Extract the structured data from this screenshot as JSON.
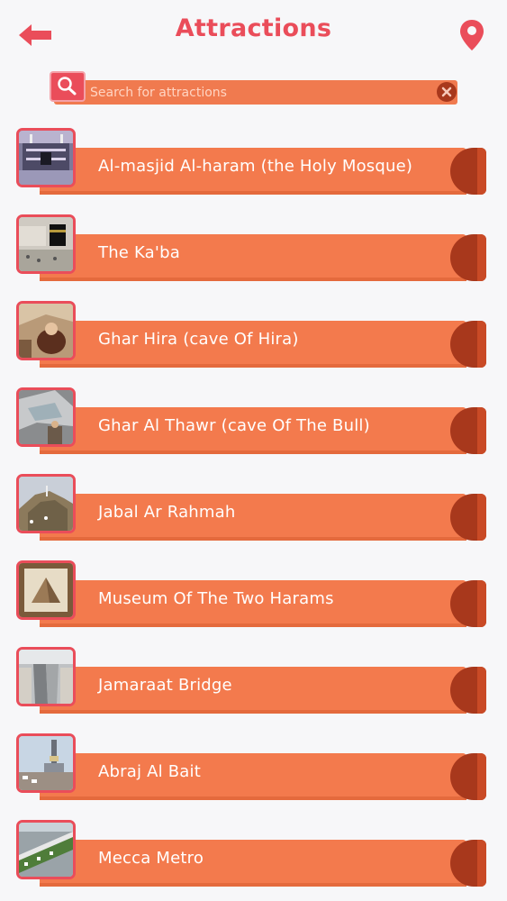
{
  "header": {
    "title": "Attractions",
    "back_icon": "arrow-left-icon",
    "map_icon": "map-pin-icon"
  },
  "search": {
    "placeholder": "Search for attractions",
    "value": "",
    "search_icon": "search-icon",
    "clear_icon": "close-icon"
  },
  "colors": {
    "accent": "#ea4d5a",
    "row_bar": "#f37a4d",
    "row_cap": "#a8381c",
    "background": "#f7f7f9"
  },
  "attractions": [
    {
      "name": "Al-masjid Al-haram (the Holy Mosque)"
    },
    {
      "name": "The Ka'ba"
    },
    {
      "name": "Ghar Hira (cave Of Hira)"
    },
    {
      "name": "Ghar Al Thawr (cave Of The Bull)"
    },
    {
      "name": "Jabal Ar Rahmah"
    },
    {
      "name": "Museum Of The Two Harams"
    },
    {
      "name": "Jamaraat Bridge"
    },
    {
      "name": "Abraj Al Bait"
    },
    {
      "name": "Mecca Metro"
    }
  ]
}
